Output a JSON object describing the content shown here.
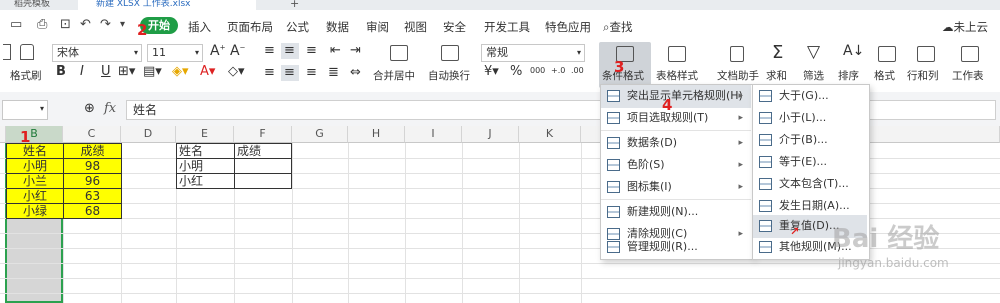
{
  "tabs": {
    "tab1": "稻壳模板",
    "tab2": "新建 XLSX 工作表.xlsx",
    "plus": "+"
  },
  "menubar": {
    "file_icon": "☰",
    "items": [
      "开始",
      "插入",
      "页面布局",
      "公式",
      "数据",
      "审阅",
      "视图",
      "安全",
      "开发工具",
      "特色应用",
      "查找"
    ],
    "cloud": "未上云"
  },
  "annotations": {
    "m1": "1",
    "m2": "2",
    "m3": "3",
    "m4": "4"
  },
  "ribbon": {
    "paste_label": "格式刷",
    "font_name": "宋体",
    "font_size": "11",
    "bold": "B",
    "italic": "I",
    "underline": "U",
    "merge_label": "合并居中",
    "wrap_label": "自动换行",
    "number_format": "常规",
    "currency": "¥",
    "percent": "%",
    "thousands": "000",
    "inc_dec": "+.0",
    "dec_dec": ".00",
    "cond_format_label": "条件格式",
    "table_style_label": "表格样式",
    "doc_helper": "文档助手",
    "sum_label": "求和",
    "filter_label": "筛选",
    "sort_label": "排序",
    "format_label": "格式",
    "rowcol_label": "行和列",
    "sheet_label": "工作表",
    "grow_font": "A",
    "shrink_font": "A"
  },
  "formula": {
    "fx": "fx",
    "value": "姓名"
  },
  "columns": [
    "B",
    "C",
    "D",
    "E",
    "F",
    "G",
    "H",
    "I",
    "J",
    "K"
  ],
  "table1": {
    "header": [
      "姓名",
      "成绩"
    ],
    "rows": [
      [
        "小明",
        "98"
      ],
      [
        "小兰",
        "96"
      ],
      [
        "小红",
        "63"
      ],
      [
        "小绿",
        "68"
      ]
    ]
  },
  "table2": {
    "header": [
      "姓名",
      "成绩"
    ],
    "rows": [
      [
        "小明",
        ""
      ],
      [
        "小红",
        ""
      ]
    ]
  },
  "menu1": [
    {
      "label": "突出显示单元格规则(H)",
      "sub": true
    },
    {
      "label": "项目选取规则(T)",
      "sub": true
    },
    {
      "label": "数据条(D)",
      "sub": true
    },
    {
      "label": "色阶(S)",
      "sub": true
    },
    {
      "label": "图标集(I)",
      "sub": true
    },
    {
      "label": "新建规则(N)...",
      "sub": false
    },
    {
      "label": "清除规则(C)",
      "sub": true
    },
    {
      "label": "管理规则(R)...",
      "sub": false
    }
  ],
  "menu2": [
    "大于(G)...",
    "小于(L)...",
    "介于(B)...",
    "等于(E)...",
    "文本包含(T)...",
    "发生日期(A)...",
    "重复值(D)...",
    "其他规则(M)..."
  ],
  "watermark": {
    "brand": "Bai 经验",
    "url": "jingyan.baidu.com"
  },
  "colors": {
    "accent": "#1f9d46",
    "highlight": "#ffff00",
    "annotation": "#e02020"
  }
}
